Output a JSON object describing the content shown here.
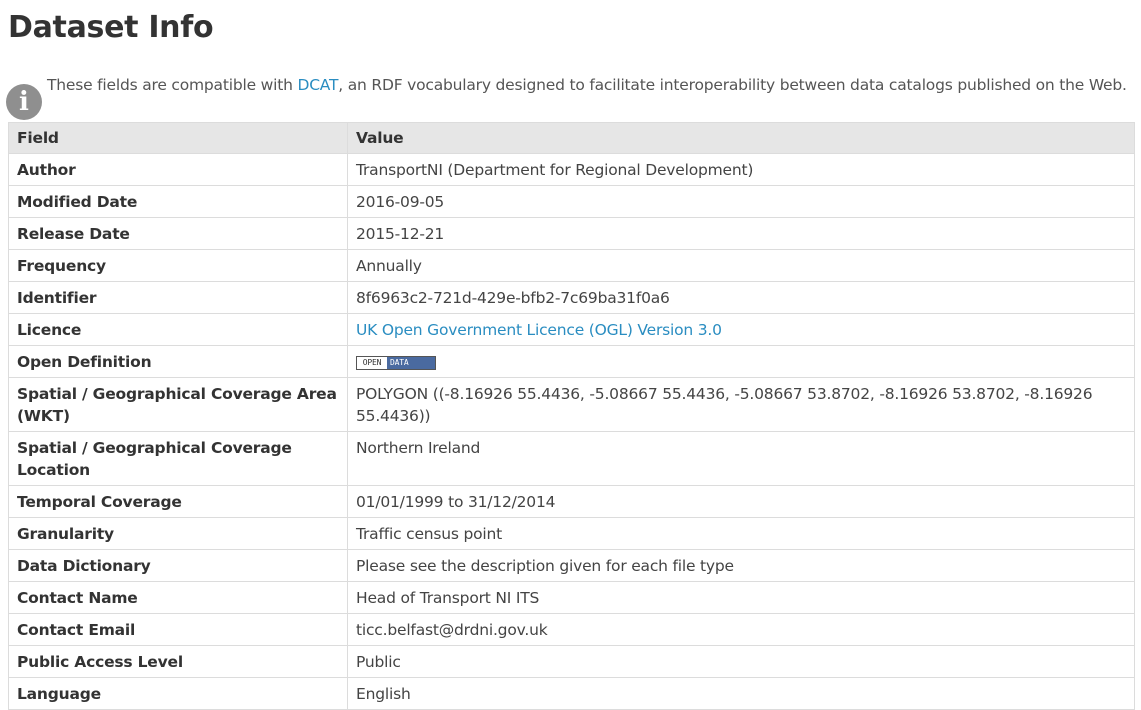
{
  "page": {
    "title": "Dataset Info"
  },
  "info": {
    "text_before": "These fields are compatible with ",
    "link_text": "DCAT",
    "text_after": ", an RDF vocabulary designed to facilitate interoperability between data catalogs published on the Web.",
    "icon": "info-icon"
  },
  "table": {
    "headers": [
      "Field",
      "Value"
    ],
    "rows": [
      {
        "field": "Author",
        "value": "TransportNI (Department for Regional Development)"
      },
      {
        "field": "Modified Date",
        "value": "2016-09-05"
      },
      {
        "field": "Release Date",
        "value": "2015-12-21"
      },
      {
        "field": "Frequency",
        "value": "Annually"
      },
      {
        "field": "Identifier",
        "value": "8f6963c2-721d-429e-bfb2-7c69ba31f0a6"
      },
      {
        "field": "Licence",
        "value": "UK Open Government Licence (OGL) Version 3.0"
      },
      {
        "field": "Open Definition",
        "badge_left": "OPEN",
        "badge_right": "DATA"
      },
      {
        "field": "Spatial / Geographical Coverage Area (WKT)",
        "value": "POLYGON ((-8.16926 55.4436, -5.08667 55.4436, -5.08667 53.8702, -8.16926 53.8702, -8.16926 55.4436))"
      },
      {
        "field": "Spatial / Geographical Coverage Location",
        "value": "Northern Ireland"
      },
      {
        "field": "Temporal Coverage",
        "value": "01/01/1999 to 31/12/2014"
      },
      {
        "field": "Granularity",
        "value": "Traffic census point"
      },
      {
        "field": "Data Dictionary",
        "value": "Please see the description given for each file type"
      },
      {
        "field": "Contact Name",
        "value": "Head of Transport NI ITS"
      },
      {
        "field": "Contact Email",
        "value": "ticc.belfast@drdni.gov.uk"
      },
      {
        "field": "Public Access Level",
        "value": "Public"
      },
      {
        "field": "Language",
        "value": "English"
      }
    ]
  },
  "colors": {
    "link": "#2a8dc1",
    "header_bg": "#e6e6e6",
    "border": "#dcdcdc",
    "icon_bg": "#8f8f8f"
  }
}
